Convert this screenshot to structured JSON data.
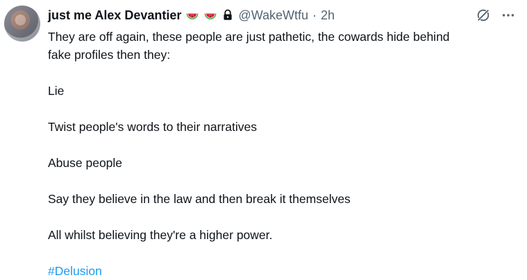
{
  "author": {
    "name": "just me Alex Devantier",
    "emojis": [
      "watermelon-icon",
      "watermelon-icon"
    ],
    "locked_icon": "lock-icon",
    "handle": "@WakeWtfu",
    "separator": "·",
    "time": "2h"
  },
  "actions": {
    "grok_icon": "grok-icon",
    "more_label": "···"
  },
  "post": {
    "line1": "They are off again, these people are just pathetic, the cowards hide behind",
    "line2": "fake profiles then they:",
    "item1": "Lie",
    "item2": "Twist people's words to their narratives",
    "item3": "Abuse people",
    "item4": "Say they believe in the law and then break it themselves",
    "item5": "All whilst believing they're a higher power.",
    "hashtag": "#Delusion"
  },
  "colors": {
    "text": "#0f1419",
    "muted": "#536471",
    "link": "#1d9bf0"
  }
}
